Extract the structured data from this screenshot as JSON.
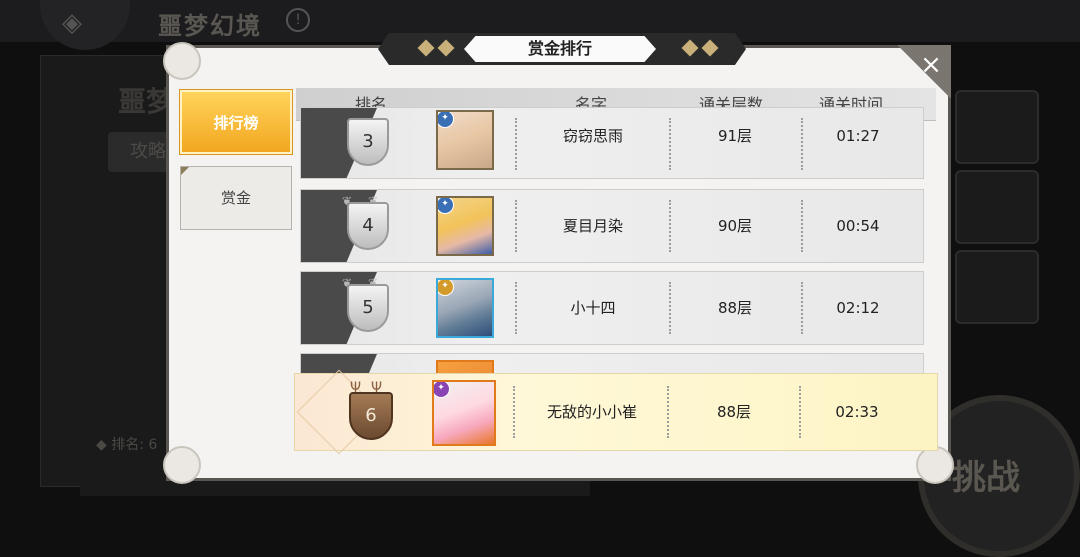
{
  "background": {
    "title": "噩梦幻境",
    "left_panel_title": "噩梦",
    "left_tab": "攻略",
    "rank_label": "◆ 排名: 6",
    "challenge_button": "挑战"
  },
  "dialog": {
    "title": "赏金排行",
    "close_icon": "×"
  },
  "tabs": [
    {
      "label": "排行榜",
      "active": true
    },
    {
      "label": "赏金",
      "active": false
    }
  ],
  "table": {
    "headers": [
      "排名",
      "名字",
      "通关层数",
      "通关时间"
    ],
    "rows": [
      {
        "rank": "3",
        "name": "窃窃思雨",
        "floors": "91层",
        "time": "01:27"
      },
      {
        "rank": "4",
        "name": "夏目月染",
        "floors": "90层",
        "time": "00:54"
      },
      {
        "rank": "5",
        "name": "小十四",
        "floors": "88层",
        "time": "02:12"
      }
    ],
    "self_row": {
      "rank": "6",
      "name": "无敌的小小崔",
      "floors": "88层",
      "time": "02:33"
    }
  },
  "colors": {
    "tab_active": "#f2a620",
    "self_row": "#fdf4c4",
    "frame": "#5a5752"
  },
  "icons": {
    "back": "diamond-back-icon",
    "info": "info-icon",
    "close": "close-icon"
  }
}
